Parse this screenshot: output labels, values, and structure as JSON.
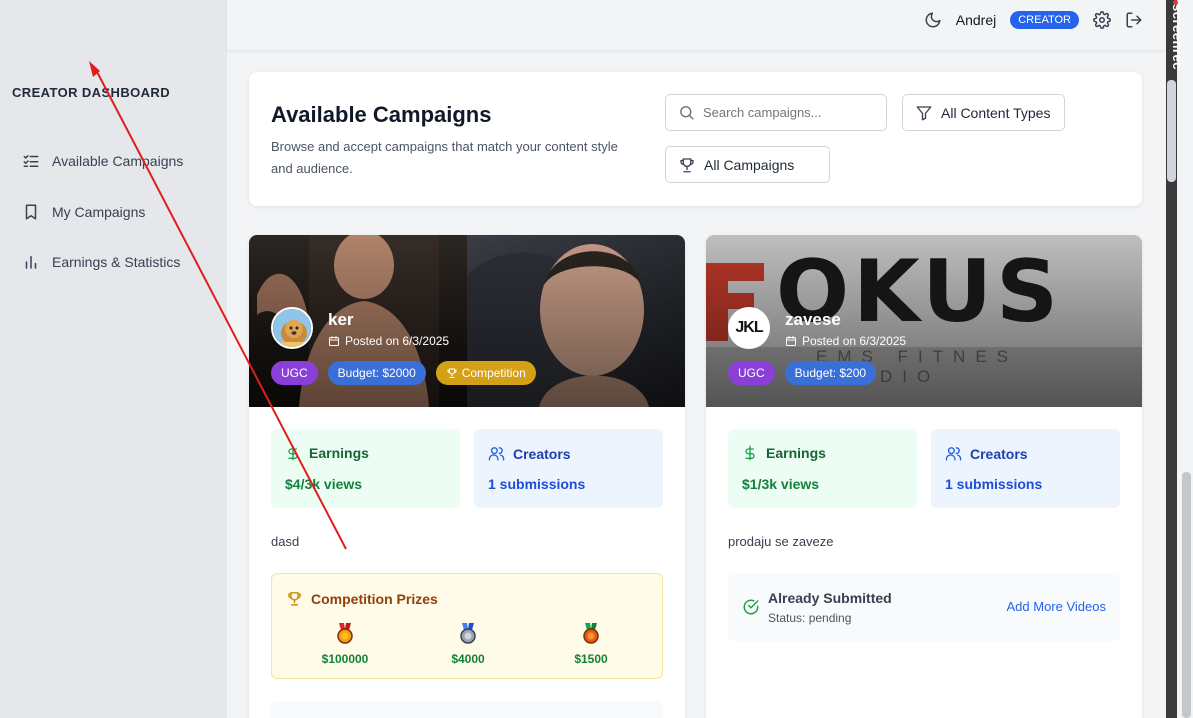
{
  "sidebar": {
    "title": "CREATOR DASHBOARD",
    "items": [
      {
        "label": "Available Campaigns",
        "icon": "list-checks-icon"
      },
      {
        "label": "My Campaigns",
        "icon": "bookmark-icon"
      },
      {
        "label": "Earnings & Statistics",
        "icon": "bar-chart-icon"
      }
    ]
  },
  "topbar": {
    "username": "Andrej",
    "role": "CREATOR"
  },
  "overlay": {
    "recorder_label": "screenrec"
  },
  "header": {
    "title": "Available Campaigns",
    "subtitle": "Browse and accept campaigns that match your content style and audience.",
    "search_placeholder": "Search campaigns...",
    "content_filter": "All Content Types",
    "campaign_filter": "All Campaigns"
  },
  "campaigns": [
    {
      "name": "ker",
      "posted": "Posted on 6/3/2025",
      "badges": {
        "type": "UGC",
        "budget": "Budget: $2000",
        "competition": "Competition"
      },
      "earnings_label": "Earnings",
      "earnings_value": "$4/3k views",
      "creators_label": "Creators",
      "creators_value": "1 submissions",
      "description": "dasd",
      "prizes_title": "Competition Prizes",
      "prizes": [
        "$100000",
        "$4000",
        "$1500"
      ]
    },
    {
      "name": "zavese",
      "posted": "Posted on 6/3/2025",
      "badges": {
        "type": "UGC",
        "budget": "Budget: $200"
      },
      "brand_text": "OKUS",
      "brand_sub": "EMS FITNES STUDIO",
      "avatar_text": "JKL",
      "earnings_label": "Earnings",
      "earnings_value": "$1/3k views",
      "creators_label": "Creators",
      "creators_value": "1 submissions",
      "description": "prodaju se zaveze",
      "submitted_title": "Already Submitted",
      "submitted_status": "Status: pending",
      "add_more": "Add More Videos"
    }
  ],
  "colors": {
    "accent": "#2563eb",
    "green": "#15803d",
    "purple": "#8b3fd9",
    "gold": "#d4a017",
    "annotation_arrow": "#e01e1e"
  }
}
